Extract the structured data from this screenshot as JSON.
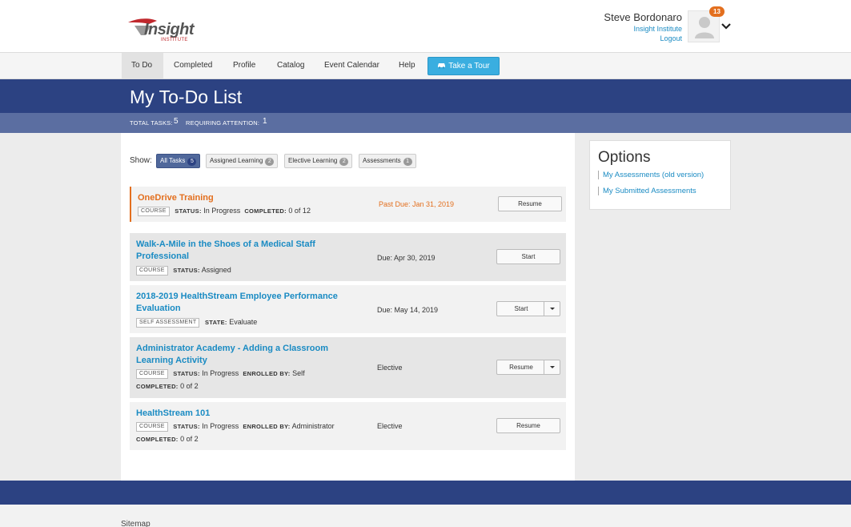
{
  "header": {
    "logo_text": "Insight",
    "logo_sub": "INSTITUTE",
    "user_name": "Steve Bordonaro",
    "org_link": "Insight Institute",
    "logout_link": "Logout",
    "notification_count": "13"
  },
  "nav": {
    "items": [
      {
        "label": "To Do",
        "active": true
      },
      {
        "label": "Completed"
      },
      {
        "label": "Profile"
      },
      {
        "label": "Catalog"
      },
      {
        "label": "Event Calendar"
      },
      {
        "label": "Help"
      }
    ],
    "tour_button": "Take a Tour"
  },
  "banner": {
    "title": "My To-Do List",
    "total_tasks_label": "TOTAL TASKS:",
    "total_tasks": "5",
    "requiring_label": "REQUIRING ATTENTION:",
    "requiring": "1"
  },
  "filters": {
    "show_label": "Show:",
    "items": [
      {
        "label": "All Tasks",
        "count": "5",
        "active": true
      },
      {
        "label": "Assigned Learning",
        "count": "2"
      },
      {
        "label": "Elective Learning",
        "count": "2"
      },
      {
        "label": "Assessments",
        "count": "1"
      }
    ]
  },
  "tasks": [
    {
      "title": "OneDrive Training",
      "type": "COURSE",
      "status_label": "STATUS:",
      "status": "In Progress",
      "extra_label": "COMPLETED:",
      "extra": "0 of 12",
      "due": "Past Due: Jan 31, 2019",
      "action": "Resume"
    },
    {
      "title": "Walk-A-Mile in the Shoes of a Medical Staff Professional",
      "type": "COURSE",
      "status_label": "STATUS:",
      "status": "Assigned",
      "due": "Due: Apr 30, 2019",
      "action": "Start"
    },
    {
      "title": "2018-2019 HealthStream Employee Performance Evaluation",
      "type": "SELF ASSESSMENT",
      "status_label": "STATE:",
      "status": "Evaluate",
      "due": "Due: May 14, 2019",
      "action": "Start"
    },
    {
      "title": "Administrator Academy - Adding a Classroom Learning Activity",
      "type": "COURSE",
      "status_label": "STATUS:",
      "status": "In Progress",
      "enrolled_label": "ENROLLED BY:",
      "enrolled": "Self",
      "completed_label": "COMPLETED:",
      "completed": "0 of 2",
      "due": "Elective",
      "action": "Resume"
    },
    {
      "title": "HealthStream 101",
      "type": "COURSE",
      "status_label": "STATUS:",
      "status": "In Progress",
      "enrolled_label": "ENROLLED BY:",
      "enrolled": "Administrator",
      "completed_label": "COMPLETED:",
      "completed": "0 of 2",
      "due": "Elective",
      "action": "Resume"
    }
  ],
  "options": {
    "title": "Options",
    "links": [
      "My Assessments (old version)",
      "My Submitted Assessments"
    ]
  },
  "footer": {
    "sitemap": "Sitemap"
  },
  "colors": {
    "brand_navy": "#2c4282",
    "link_blue": "#1a8bc3",
    "overdue_orange": "#e36f1e",
    "tour_blue": "#3aaee0"
  }
}
